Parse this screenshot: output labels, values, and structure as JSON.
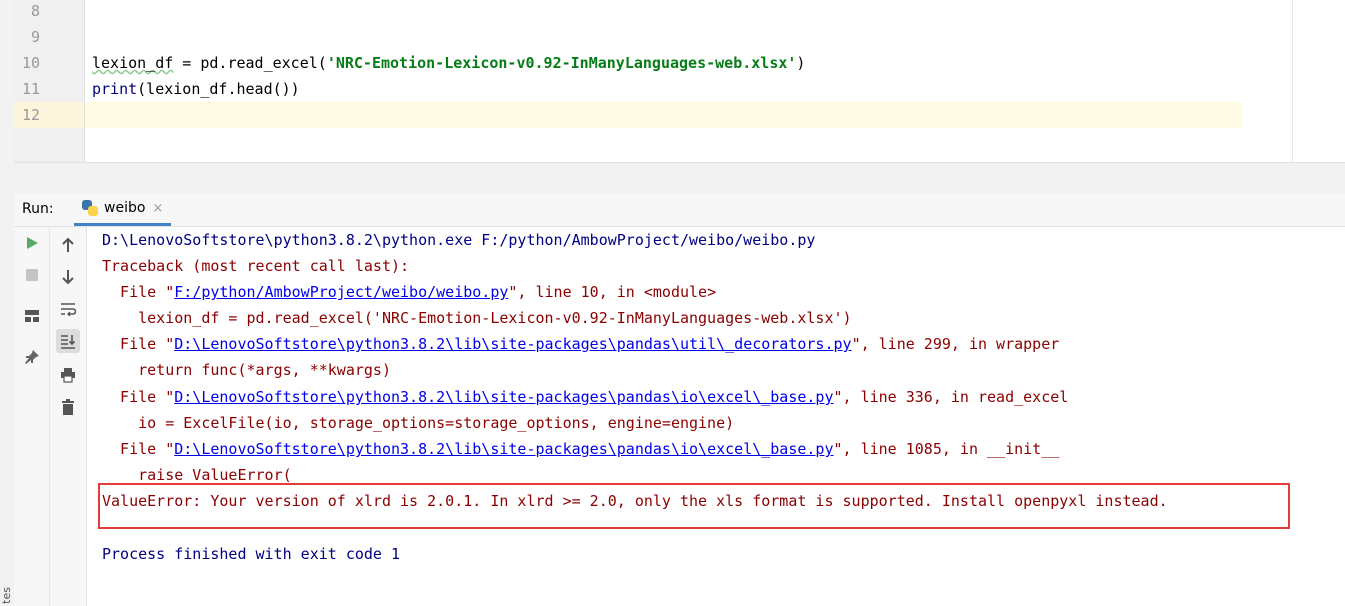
{
  "edge_strip": {
    "text": "tes"
  },
  "editor": {
    "lines": [
      {
        "num": "8",
        "code": ""
      },
      {
        "num": "9",
        "code": ""
      },
      {
        "num": "10",
        "pre": "lexion_df",
        "mid": " = pd.read_excel(",
        "str": "'NRC-Emotion-Lexicon-v0.92-InManyLanguages-web.xlsx'",
        "post": ")"
      },
      {
        "num": "11",
        "fn": "print",
        "rest": "(lexion_df.head())"
      },
      {
        "num": "12",
        "code": ""
      }
    ],
    "current_line": "12"
  },
  "run_panel": {
    "label": "Run:",
    "tab_label": "weibo",
    "tab_close": "×",
    "toolbar": {
      "rerun": "rerun-icon",
      "stop": "stop-icon",
      "up": "up-arrow-icon",
      "down": "down-arrow-icon",
      "soft_wrap": "soft-wrap-icon",
      "scroll_end": "scroll-to-end-icon",
      "layout": "layout-icon",
      "print": "print-icon",
      "pin": "pin-icon",
      "trash": "trash-icon"
    }
  },
  "console": {
    "cmd": "D:\\LenovoSoftstore\\python3.8.2\\python.exe F:/python/AmbowProject/weibo/weibo.py",
    "traceback_header": "Traceback (most recent call last):",
    "frames": [
      {
        "prefix": "  File \"",
        "path": "F:/python/AmbowProject/weibo/weibo.py",
        "suffix": "\", line 10, in <module>",
        "code": "    lexion_df = pd.read_excel('NRC-Emotion-Lexicon-v0.92-InManyLanguages-web.xlsx')"
      },
      {
        "prefix": "  File \"",
        "path": "D:\\LenovoSoftstore\\python3.8.2\\lib\\site-packages\\pandas\\util\\_decorators.py",
        "suffix": "\", line 299, in wrapper",
        "code": "    return func(*args, **kwargs)"
      },
      {
        "prefix": "  File \"",
        "path": "D:\\LenovoSoftstore\\python3.8.2\\lib\\site-packages\\pandas\\io\\excel\\_base.py",
        "suffix": "\", line 336, in read_excel",
        "code": "    io = ExcelFile(io, storage_options=storage_options, engine=engine)"
      },
      {
        "prefix": "  File \"",
        "path": "D:\\LenovoSoftstore\\python3.8.2\\lib\\site-packages\\pandas\\io\\excel\\_base.py",
        "suffix": "\", line 1085, in __init__",
        "code": "    raise ValueError("
      }
    ],
    "error": "ValueError: Your version of xlrd is 2.0.1. In xlrd >= 2.0, only the xls format is supported. Install openpyxl instead.",
    "exit": "Process finished with exit code 1"
  },
  "colors": {
    "highlight_box": "#e33b3b",
    "link": "#0000ee",
    "error_text": "#8b0000",
    "cmd_text": "#000080",
    "tab_underline": "#4083c9"
  }
}
